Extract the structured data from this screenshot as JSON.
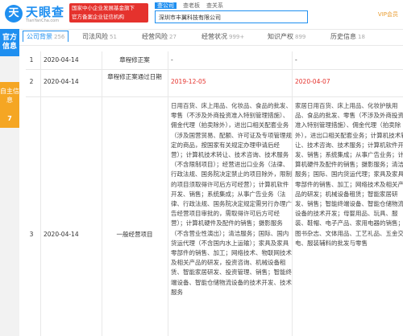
{
  "header": {
    "logo_char": "天",
    "brand": "天眼查",
    "brand_sub": "TianYanCha.com",
    "banner_line1": "国家中小企业发展基金旗下",
    "banner_line2": "官方备案企业征信机构",
    "search_tabs": [
      "查公司",
      "查老板",
      "查关系"
    ],
    "search_value": "深圳市丰翼科技有限公司",
    "vip_label": "VIP会员"
  },
  "sidebar": {
    "items": [
      {
        "label": "官方信息"
      },
      {
        "label": "自主信息"
      },
      {
        "label": "7"
      }
    ]
  },
  "tabs": [
    {
      "label": "公司背景",
      "count": "256"
    },
    {
      "label": "司法风险",
      "count": "51"
    },
    {
      "label": "经营风险",
      "count": "27"
    },
    {
      "label": "经营状况",
      "count": "999+"
    },
    {
      "label": "知识产权",
      "count": "899"
    },
    {
      "label": "历史信息",
      "count": "18"
    }
  ],
  "rows": [
    {
      "num": "1",
      "date": "2020-04-14",
      "item": "章程修正案",
      "before": "-",
      "after": "-"
    },
    {
      "num": "2",
      "date": "2020-04-14",
      "item": "章程修正案通过日期",
      "before": "2019-12-05",
      "after": "2020-04-07"
    },
    {
      "num": "3",
      "date": "2020-04-14",
      "item": "一般经营项目",
      "before": "日用百货、床上用品、化妆品、食品的批发、零售（不涉及外商投资准入特别管理措施）、佣金代理（拍卖除外），进出口相关配套业务（涉及国营贸易、配额、许可证及专项管理规定的商品，按国家有关规定办理申请后经营）；计算机技术转让、技术咨询、技术服务（不含限制项目）；经营进出口业务（法律、行政法规、国务院决定禁止的项目除外，限制的项目须取得许可后方可经营）；计算机软件开发、销售；系统集成；从事广告业务（法律、行政法规、国务院决定规定需另行办理广告经营项目审批的，需取得许可后方可经营）；计算机硬件及配件的销售；摄影服务（不含营业性演出）；清洁服务；国际、国内货运代理（不含国内水上运输）；家具及家具零部件的销售、加工；网络技术、物联网技术及相关产品的研发，投资咨询、机械设备租赁、智能家居研发、投资管理、销售；智能终端设备、智能仓储物流设备的技术开发、技术服务",
      "after": "家居日用百货、床上用品、化妆护肤用品、食品的批发、零售（不涉及外商投资准入特别管理措施）、佣金代理（拍卖除外），进出口相关配套业务；计算机技术转让、技术咨询、技术服务；计算机软件开发、销售；系统集成；从事广告业务；计算机硬件及配件的销售；摄影服务；清洁服务；国际、国内货运代理；家具及家具零部件的销售、加工；网络技术及相关产品的研发；机械设备租赁；智能家居研发、销售；智能终端设备、智能仓储物流设备的技术开发；母婴用品、玩具、服装、鞋帽、电子产品、家用电器的销售；图书杂志、文体用品、工艺礼品、五金交电、服装辅料的批发与零售"
    }
  ]
}
